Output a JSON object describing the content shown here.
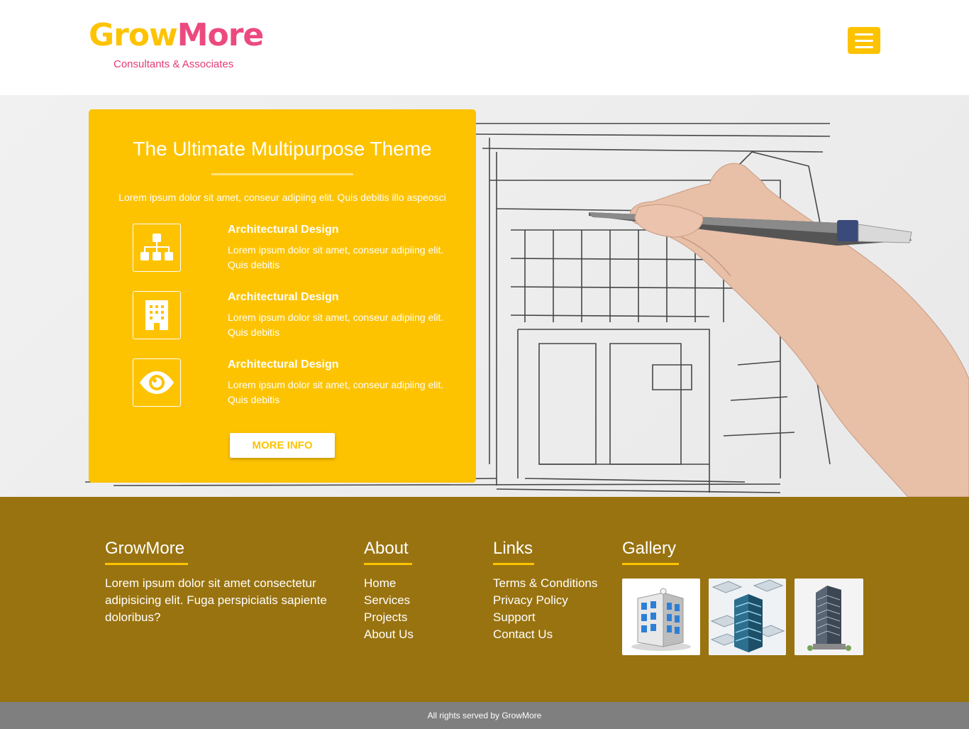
{
  "header": {
    "logo_part1": "Grow",
    "logo_part2": "More",
    "tagline": "Consultants & Associates",
    "menu_icon": "hamburger-menu-icon"
  },
  "hero": {
    "title": "The Ultimate Multipurpose Theme",
    "intro": "Lorem ipsum dolor sit amet, conseur adipiing elit. Quis debitis illo aspeosci",
    "features": [
      {
        "icon": "sitemap-icon",
        "title": "Architectural Design",
        "text": "Lorem ipsum dolor sit amet, conseur adipiing elit. Quis debitis"
      },
      {
        "icon": "building-icon",
        "title": "Architectural Design",
        "text": "Lorem ipsum dolor sit amet, conseur adipiing elit. Quis debitis"
      },
      {
        "icon": "eye-icon",
        "title": "Architectural Design",
        "text": "Lorem ipsum dolor sit amet, conseur adipiing elit. Quis debitis"
      }
    ],
    "button_label": "MORE INFO"
  },
  "footer": {
    "about_col": {
      "heading": "GrowMore",
      "text": "Lorem ipsum dolor sit amet consectetur adipisicing elit. Fuga perspiciatis sapiente doloribus?"
    },
    "about_links": {
      "heading": "About",
      "items": [
        "Home",
        "Services",
        "Projects",
        "About Us"
      ]
    },
    "links": {
      "heading": "Links",
      "items": [
        "Terms & Conditions",
        "Privacy Policy",
        "Support",
        "Contact Us"
      ]
    },
    "gallery": {
      "heading": "Gallery"
    }
  },
  "copyright": "All rights served by GrowMore",
  "colors": {
    "accent": "#fdc300",
    "brand_pink": "#ec4a7f",
    "footer_bg": "#99730f",
    "bottom_bar": "#7f7f7f"
  }
}
